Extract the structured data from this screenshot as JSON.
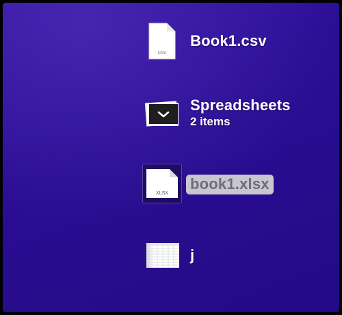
{
  "desktop": {
    "items": [
      {
        "name": "Book1.csv",
        "icon": "csv-file-icon",
        "badge": "CSV"
      },
      {
        "name": "Spreadsheets",
        "subtitle": "2 items",
        "icon": "stack-folder-icon"
      },
      {
        "name": "book1.xlsx",
        "icon": "xlsx-file-icon",
        "badge": "XLSX",
        "selected": true
      },
      {
        "name": "j",
        "icon": "spreadsheet-thumbnail-icon"
      }
    ]
  }
}
